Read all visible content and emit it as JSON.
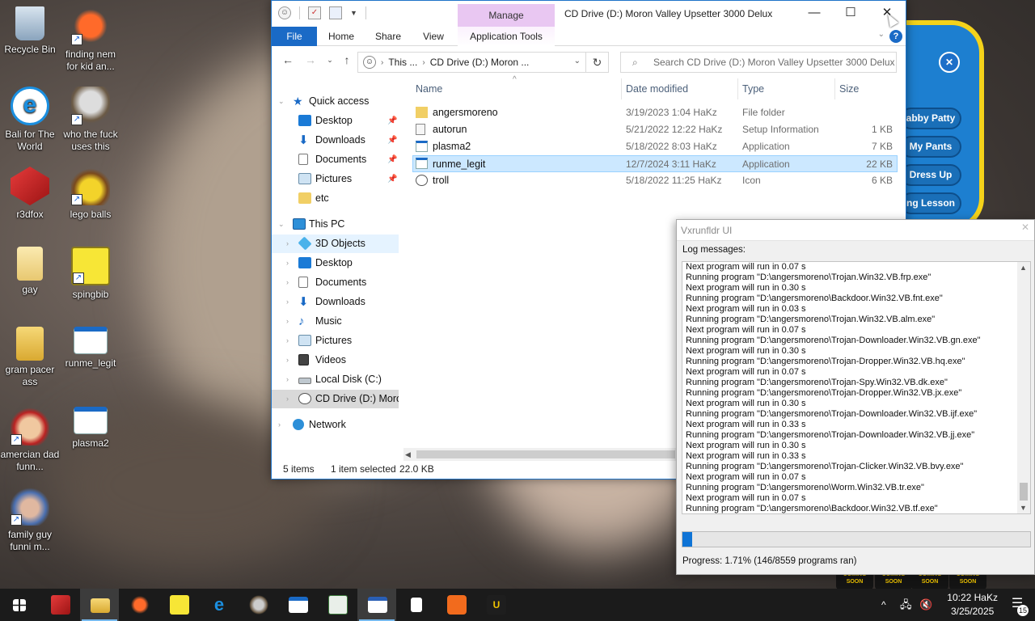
{
  "desktop": {
    "icons": [
      {
        "label": "Recycle Bin"
      },
      {
        "label": "finding nem for kid an..."
      },
      {
        "label": "Bali for The World"
      },
      {
        "label": "who the fuck uses this"
      },
      {
        "label": "r3dfox"
      },
      {
        "label": "lego balls"
      },
      {
        "label": "gay"
      },
      {
        "label": "spingbib"
      },
      {
        "label": "gram pacer ass"
      },
      {
        "label": "runme_legit"
      },
      {
        "label": "amercian dad funn..."
      },
      {
        "label": "plasma2"
      },
      {
        "label": "family guy funni m..."
      }
    ]
  },
  "game": {
    "buttons": [
      "abby Patty",
      "My Pants",
      "Dress Up",
      "ng Lesson"
    ],
    "coming_soon": [
      "COMING SOON",
      "COMING SOON",
      "COMING SOON",
      "COMING SOON"
    ]
  },
  "explorer": {
    "manage_tab": "Manage",
    "title": "CD Drive (D:) Moron Valley Upsetter 3000 Delux",
    "ribbon": {
      "file": "File",
      "home": "Home",
      "share": "Share",
      "view": "View",
      "app_tools": "Application Tools",
      "help": "?"
    },
    "address": {
      "seg1": "This ...",
      "seg2": "CD Drive (D:) Moron ..."
    },
    "search_placeholder": "Search CD Drive (D:) Moron Valley Upsetter 3000 Delux",
    "nav": {
      "quick_access": "Quick access",
      "qa_items": [
        "Desktop",
        "Downloads",
        "Documents",
        "Pictures",
        "etc"
      ],
      "this_pc": "This PC",
      "pc_items": [
        "3D Objects",
        "Desktop",
        "Documents",
        "Downloads",
        "Music",
        "Pictures",
        "Videos",
        "Local Disk (C:)",
        "CD Drive (D:) Moron Valley Upsetter 3000 Delux"
      ],
      "network": "Network"
    },
    "columns": {
      "name": "Name",
      "date": "Date modified",
      "type": "Type",
      "size": "Size"
    },
    "files": [
      {
        "name": "angersmoreno",
        "date": "3/19/2023 1:04 HaKz",
        "type": "File folder",
        "size": ""
      },
      {
        "name": "autorun",
        "date": "5/21/2022 12:22 HaKz",
        "type": "Setup Information",
        "size": "1 KB"
      },
      {
        "name": "plasma2",
        "date": "5/18/2022 8:03 HaKz",
        "type": "Application",
        "size": "7 KB"
      },
      {
        "name": "runme_legit",
        "date": "12/7/2024 3:11 HaKz",
        "type": "Application",
        "size": "22 KB"
      },
      {
        "name": "troll",
        "date": "5/18/2022 11:25 HaKz",
        "type": "Icon",
        "size": "6 KB"
      }
    ],
    "status": {
      "items": "5 items",
      "selected": "1 item selected",
      "size": "22.0 KB"
    }
  },
  "vxrunfldr": {
    "title": "Vxrunfldr UI",
    "log_label": "Log messages:",
    "log": [
      "Next program will run in 0.07 s",
      "Running program \"D:\\angersmoreno\\Trojan.Win32.VB.frp.exe\"",
      "Next program will run in 0.30 s",
      "Running program \"D:\\angersmoreno\\Backdoor.Win32.VB.fnt.exe\"",
      "Next program will run in 0.03 s",
      "Running program \"D:\\angersmoreno\\Trojan.Win32.VB.alm.exe\"",
      "Next program will run in 0.07 s",
      "Running program \"D:\\angersmoreno\\Trojan-Downloader.Win32.VB.gn.exe\"",
      "Next program will run in 0.30 s",
      "Running program \"D:\\angersmoreno\\Trojan-Dropper.Win32.VB.hq.exe\"",
      "Next program will run in 0.07 s",
      "Running program \"D:\\angersmoreno\\Trojan-Spy.Win32.VB.dk.exe\"",
      "Running program \"D:\\angersmoreno\\Trojan-Dropper.Win32.VB.jx.exe\"",
      "Next program will run in 0.30 s",
      "Running program \"D:\\angersmoreno\\Trojan-Downloader.Win32.VB.ijf.exe\"",
      "Next program will run in 0.33 s",
      "Running program \"D:\\angersmoreno\\Trojan-Downloader.Win32.VB.jj.exe\"",
      "Next program will run in 0.30 s",
      "Next program will run in 0.33 s",
      "Running program \"D:\\angersmoreno\\Trojan-Clicker.Win32.VB.bvy.exe\"",
      "Next program will run in 0.07 s",
      "Running program \"D:\\angersmoreno\\Worm.Win32.VB.tr.exe\"",
      "Next program will run in 0.07 s",
      "Running program \"D:\\angersmoreno\\Backdoor.Win32.VB.tf.exe\""
    ],
    "progress_fraction": 0.0171,
    "progress_text": "Progress: 1.71% (146/8559 programs ran)"
  },
  "taskbar": {
    "clock_time": "10:22 HaKz",
    "clock_date": "3/25/2025",
    "notifications": "15"
  },
  "colors": {
    "accent": "#1a6ac6",
    "selection": "#cce8ff",
    "progress": "#0f74d6",
    "manage": "#e9c7f2"
  }
}
